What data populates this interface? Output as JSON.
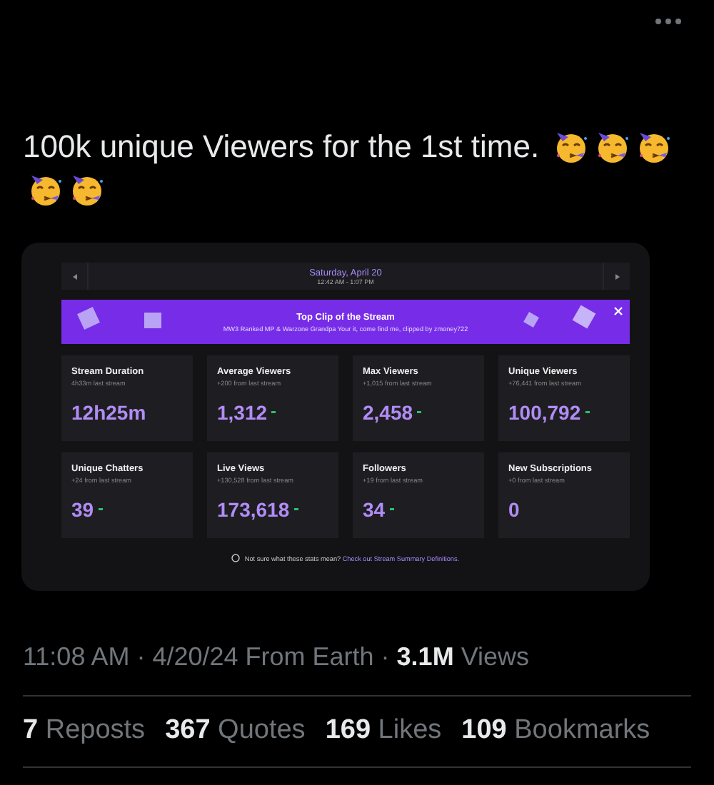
{
  "post": {
    "text": "100k unique Viewers for the 1st time.",
    "emojis": [
      {
        "kind": "party-face"
      },
      {
        "kind": "party-face"
      },
      {
        "kind": "party-face"
      },
      {
        "kind": "party-face"
      },
      {
        "kind": "party-face"
      }
    ]
  },
  "summary": {
    "date": "Saturday, April 20",
    "time_range": "12:42 AM - 1:07 PM",
    "clip_banner": {
      "title": "Top Clip of the Stream",
      "subtitle": "MW3 Ranked MP & Warzone Grandpa Your it, come find me, clipped by zmoney722"
    },
    "stats": [
      {
        "title": "Stream Duration",
        "comparison": "4h33m last stream",
        "value": "12h25m",
        "trend": false
      },
      {
        "title": "Average Viewers",
        "comparison": "+200 from last stream",
        "value": "1,312",
        "trend": true
      },
      {
        "title": "Max Viewers",
        "comparison": "+1,015 from last stream",
        "value": "2,458",
        "trend": true
      },
      {
        "title": "Unique Viewers",
        "comparison": "+76,441 from last stream",
        "value": "100,792",
        "trend": true
      },
      {
        "title": "Unique Chatters",
        "comparison": "+24 from last stream",
        "value": "39",
        "trend": true
      },
      {
        "title": "Live Views",
        "comparison": "+130,528 from last stream",
        "value": "173,618",
        "trend": true
      },
      {
        "title": "Followers",
        "comparison": "+19 from last stream",
        "value": "34",
        "trend": true
      },
      {
        "title": "New Subscriptions",
        "comparison": "+0 from last stream",
        "value": "0",
        "trend": false
      }
    ],
    "help_text": "Not sure what these stats mean?",
    "help_link": "Check out Stream Summary Definitions."
  },
  "meta": "11:08 AM · 4/20/24 From Earth · **3.1M** Views",
  "engagement": [
    {
      "count": "7",
      "label": "Reposts"
    },
    {
      "count": "367",
      "label": "Quotes"
    },
    {
      "count": "169",
      "label": "Likes"
    },
    {
      "count": "109",
      "label": "Bookmarks"
    }
  ]
}
